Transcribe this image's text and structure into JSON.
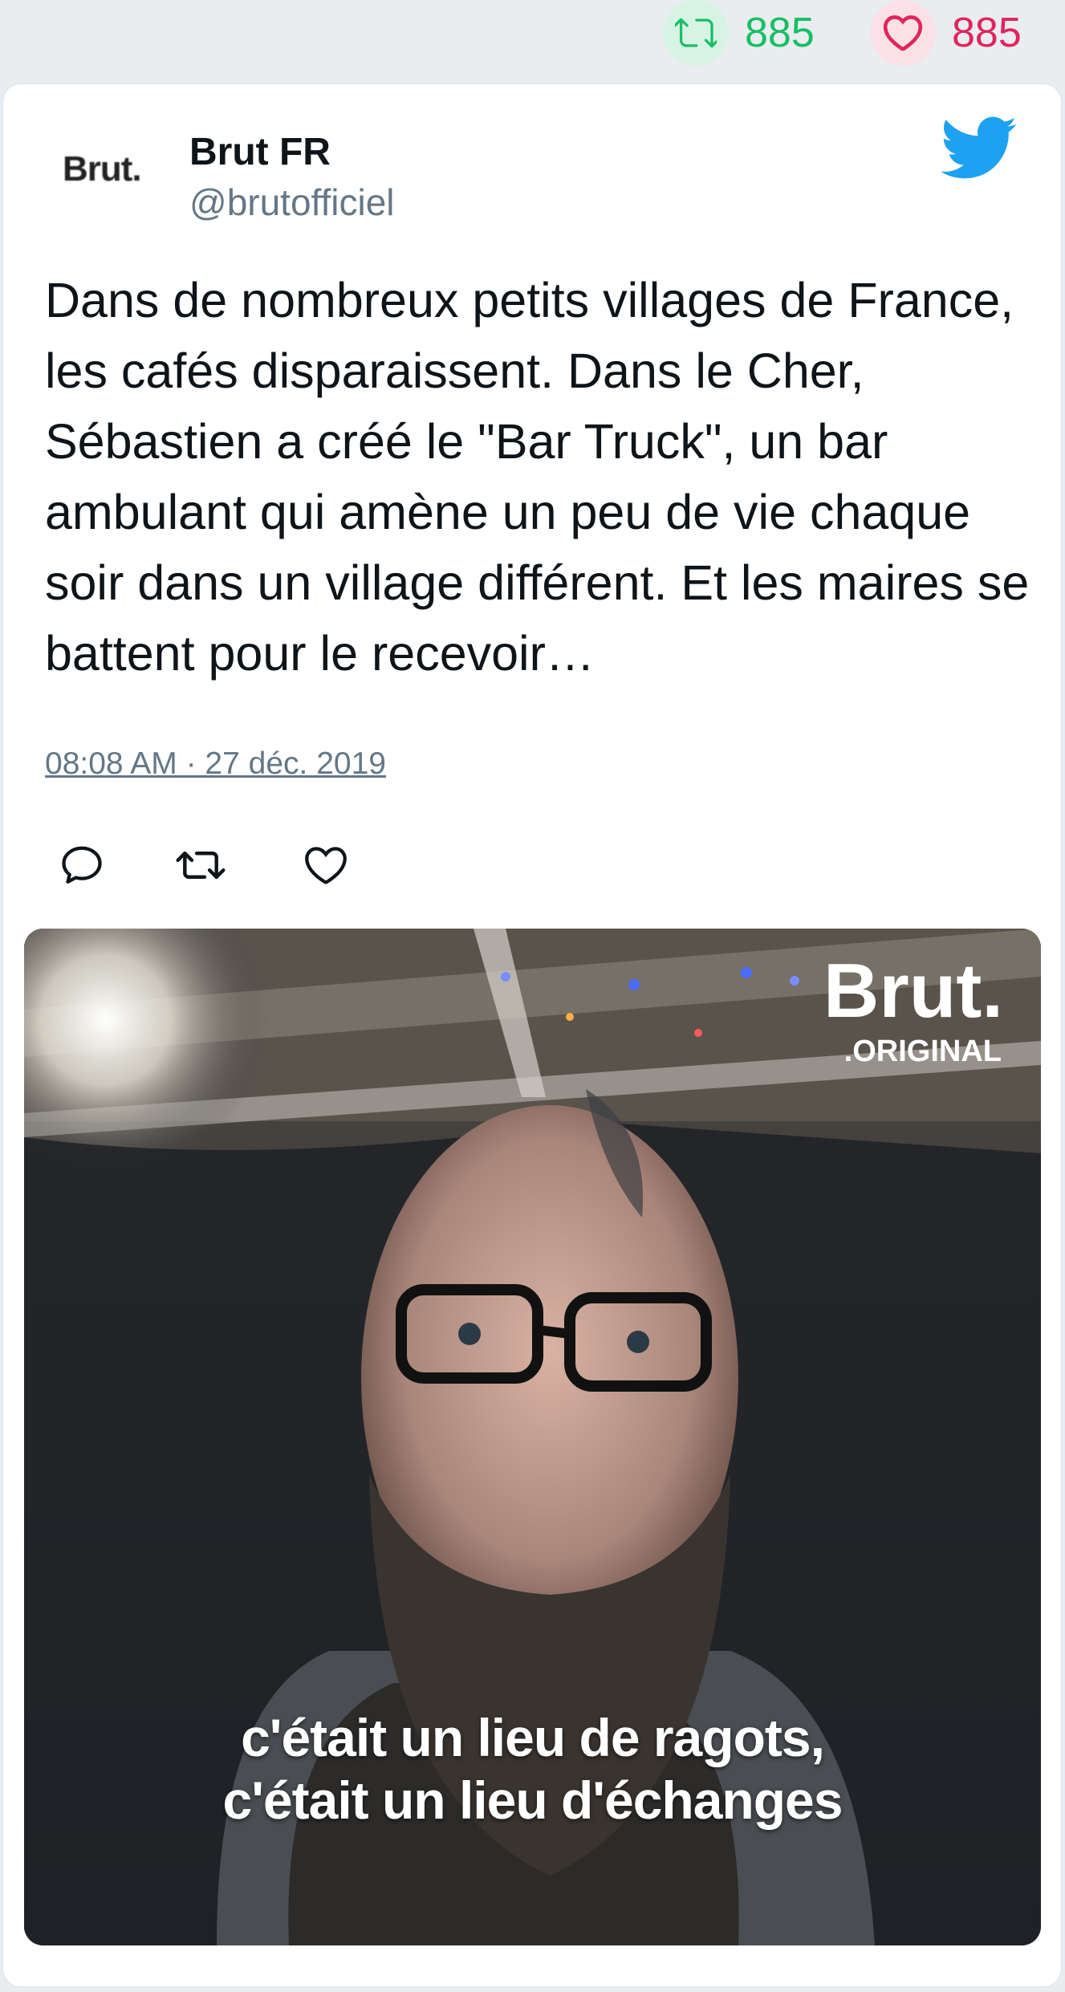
{
  "stats": {
    "retweet_count": "885",
    "like_count": "885"
  },
  "tweet": {
    "author_logo": "Brut.",
    "author_name": "Brut FR",
    "author_handle": "@brutofficiel",
    "text": "Dans de nombreux petits villages de France, les cafés disparaissent. Dans le Cher, Sébastien a créé le \"Bar Truck\", un bar ambulant qui amène un peu de vie chaque soir dans un village différent. Et les maires se battent pour le recevoir…",
    "timestamp": "08:08 AM · 27 déc. 2019"
  },
  "media": {
    "watermark_brand": "Brut.",
    "watermark_sub": ".ORIGINAL",
    "caption_line1": "c'était un lieu de ragots,",
    "caption_line2": "c'était un lieu d'échanges"
  },
  "icons": {
    "retweet": "retweet-icon",
    "like": "heart-icon",
    "reply": "reply-icon",
    "brand": "twitter-bird-icon"
  },
  "colors": {
    "retweet_green": "#17bf63",
    "like_red": "#e0245e",
    "twitter_blue": "#1da1f2",
    "muted_gray": "#657786"
  }
}
